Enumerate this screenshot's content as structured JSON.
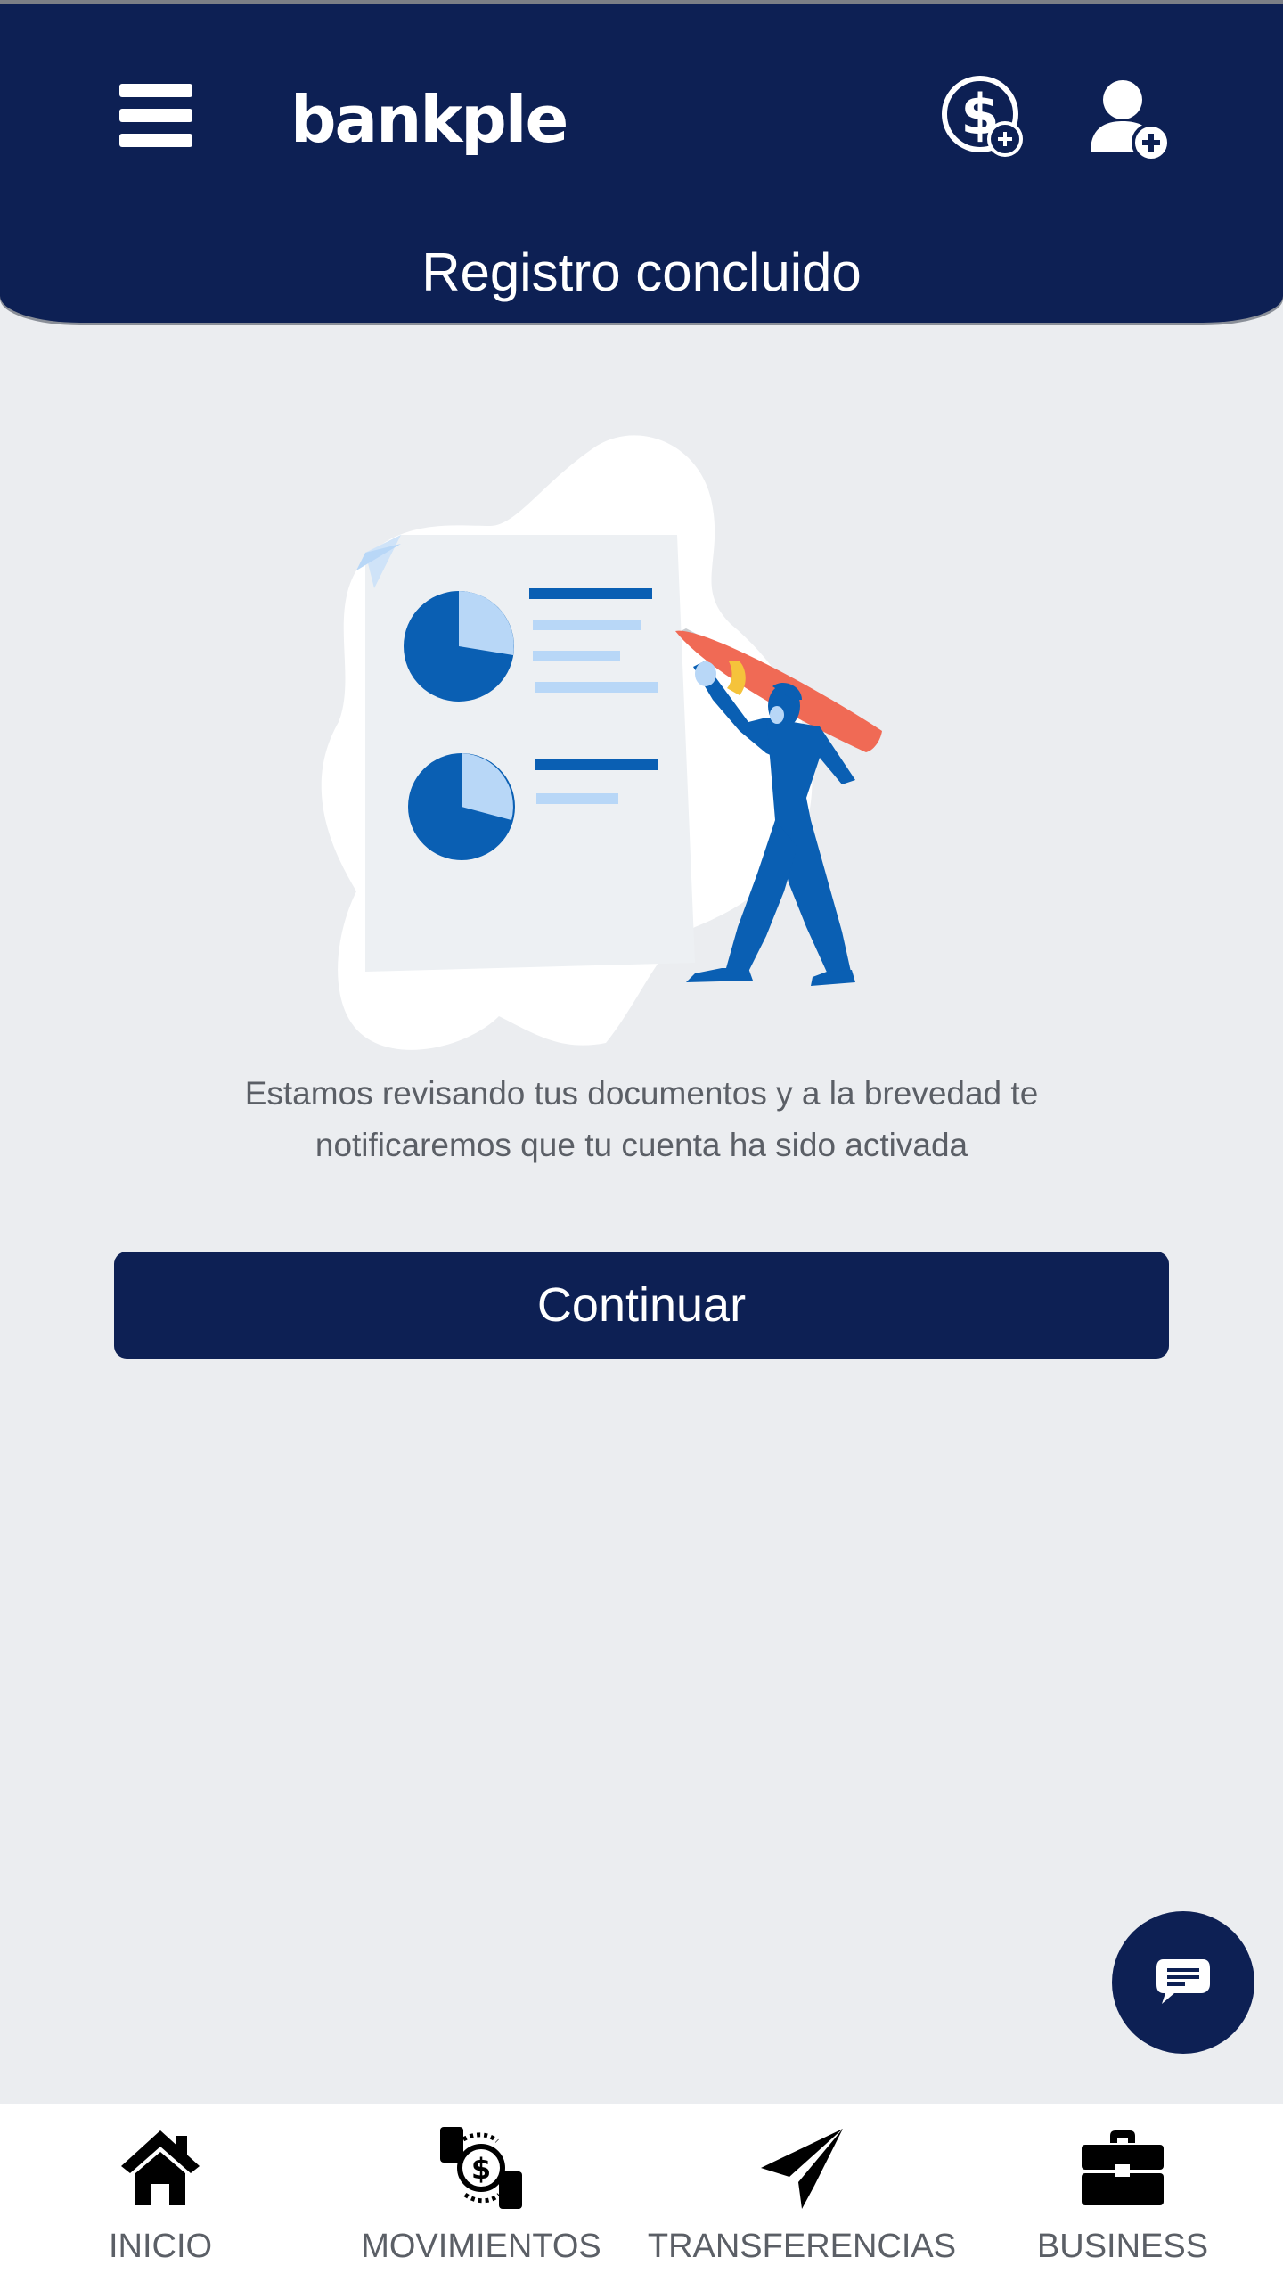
{
  "header": {
    "logo_text": "bankple",
    "title": "Registro concluido",
    "icons": [
      "menu-icon",
      "dollar-add-icon",
      "user-add-icon"
    ]
  },
  "main": {
    "message": "Estamos revisando tus documentos y a la brevedad te notificaremos que tu cuenta ha sido activada",
    "continue_label": "Continuar"
  },
  "bottom_nav": {
    "items": [
      {
        "label": "INICIO",
        "icon": "home-icon"
      },
      {
        "label": "MOVIMIENTOS",
        "icon": "money-exchange-icon"
      },
      {
        "label": "TRANSFERENCIAS",
        "icon": "paper-plane-icon"
      },
      {
        "label": "BUSINESS",
        "icon": "briefcase-icon"
      }
    ]
  },
  "chat": {
    "icon": "chat-icon"
  },
  "colors": {
    "primary": "#0d2054",
    "background": "#ebedf0",
    "illustration_blue": "#0a5fb3",
    "illustration_light_blue": "#b8d7f7",
    "accent_red": "#f06a55"
  }
}
